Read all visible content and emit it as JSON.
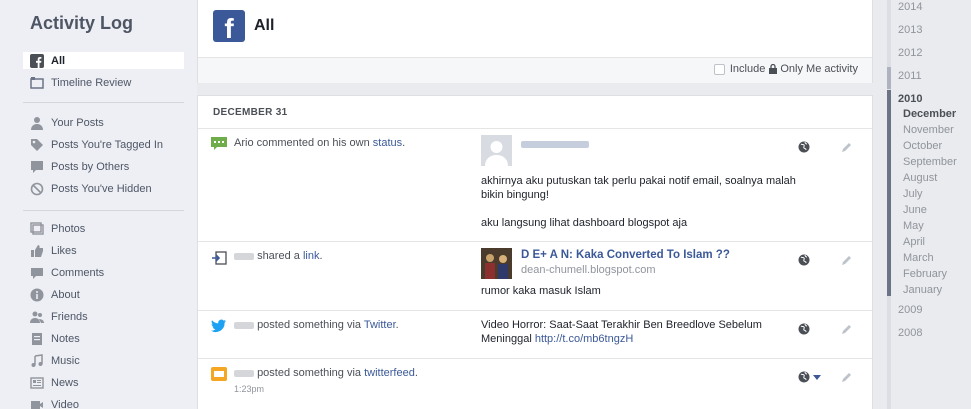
{
  "sidebar": {
    "title": "Activity Log",
    "items": [
      {
        "label": "All",
        "icon": "facebook-icon",
        "active": true
      },
      {
        "label": "Timeline Review",
        "icon": "timeline-review-icon"
      },
      {
        "label": "Your Posts",
        "icon": "person-icon"
      },
      {
        "label": "Posts You're Tagged In",
        "icon": "tag-icon"
      },
      {
        "label": "Posts by Others",
        "icon": "speech-icon"
      },
      {
        "label": "Posts You've Hidden",
        "icon": "hidden-icon"
      },
      {
        "label": "Photos",
        "icon": "photos-icon"
      },
      {
        "label": "Likes",
        "icon": "thumbs-up-icon"
      },
      {
        "label": "Comments",
        "icon": "comment-icon"
      },
      {
        "label": "About",
        "icon": "info-icon"
      },
      {
        "label": "Friends",
        "icon": "friends-icon"
      },
      {
        "label": "Notes",
        "icon": "notes-icon"
      },
      {
        "label": "Music",
        "icon": "music-icon"
      },
      {
        "label": "News",
        "icon": "news-icon"
      },
      {
        "label": "Video",
        "icon": "video-icon"
      }
    ]
  },
  "header": {
    "title": "All",
    "filter": {
      "include": "Include",
      "only_me": "Only Me activity"
    }
  },
  "log": {
    "date": "DECEMBER 31",
    "rows": [
      {
        "story_pre": "Ario commented on his own",
        "story_link": "status",
        "story_post": ".",
        "content_lines": [
          "akhirnya aku putuskan tak perlu pakai notif email, soalnya malah",
          "bikin bingung!",
          "aku langsung lihat dashboard blogspot aja"
        ]
      },
      {
        "story_pre": "shared a",
        "story_link": "link",
        "story_post": ".",
        "link_title": "D E+ A N: Kaka Converted To Islam ??",
        "link_domain": "dean-chumell.blogspot.com",
        "content_line": "rumor kaka masuk Islam"
      },
      {
        "story_pre": "posted something via",
        "story_link": "Twitter",
        "story_post": ".",
        "content_line1": "Video Horror: Saat-Saat Terakhir Ben Breedlove Sebelum",
        "content_line2_pre": "Meninggal",
        "content_url": "http://t.co/mb6tngzH"
      },
      {
        "story_pre": "posted something via",
        "story_link": "twitterfeed",
        "story_post": ".",
        "time": "1:23pm"
      }
    ]
  },
  "years": {
    "list": [
      "2014",
      "2013",
      "2012",
      "2011",
      "2010"
    ],
    "active": "2010",
    "months": [
      "December",
      "November",
      "October",
      "September",
      "August",
      "July",
      "June",
      "May",
      "April",
      "March",
      "February",
      "January"
    ],
    "later": [
      "2009",
      "2008"
    ]
  },
  "colors": {
    "brand": "#3b5998",
    "link": "#3b5998"
  }
}
